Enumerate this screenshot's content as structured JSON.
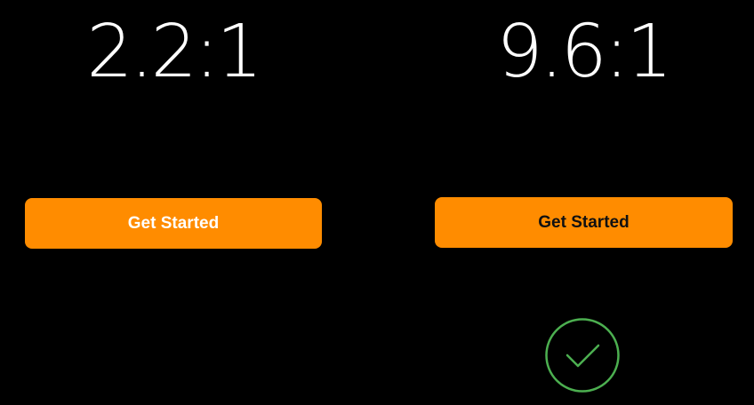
{
  "examples": [
    {
      "ratio": "2.2:1",
      "button_label": "Get Started",
      "button_bg": "#ff8c00",
      "button_text_color": "#ffffff"
    },
    {
      "ratio": "9.6:1",
      "button_label": "Get Started",
      "button_bg": "#ff8c00",
      "button_text_color": "#111111",
      "badge_icon": "check-circle-icon",
      "badge_color": "#4caf50"
    }
  ]
}
